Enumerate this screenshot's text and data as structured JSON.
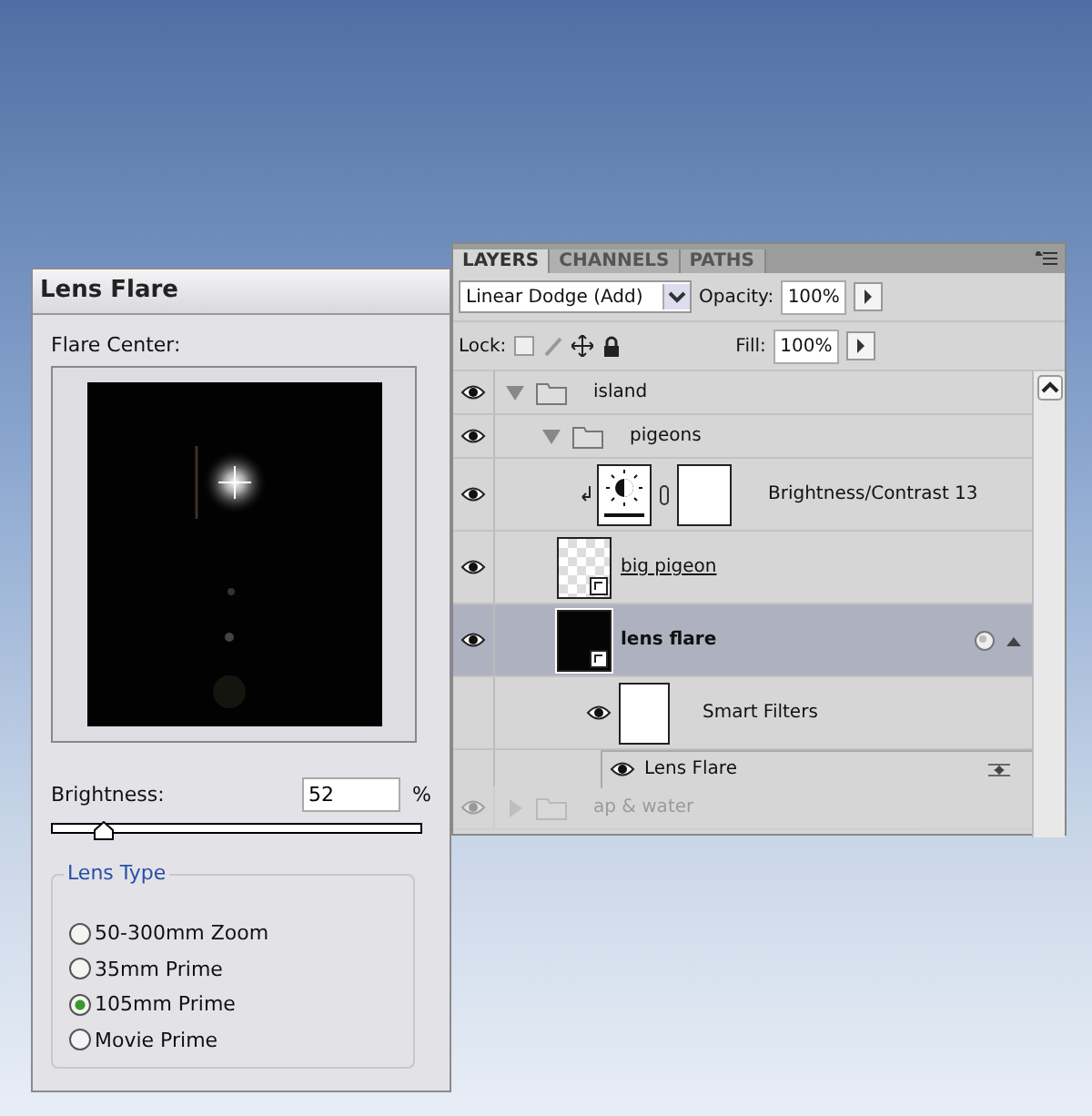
{
  "lens_flare_dialog": {
    "title": "Lens Flare",
    "preview_label": "Flare Center:",
    "brightness_label": "Brightness:",
    "brightness_value": "52",
    "brightness_unit": "%",
    "brightness_slider": {
      "level": 0.14
    },
    "lens_type_title": "Lens Type",
    "lens_types": [
      {
        "label": "50-300mm Zoom",
        "selected": false
      },
      {
        "label": "35mm Prime",
        "selected": false
      },
      {
        "label": "105mm Prime",
        "selected": true
      },
      {
        "label": "Movie Prime",
        "selected": false
      }
    ]
  },
  "layers_panel": {
    "tabs": [
      {
        "label": "LAYERS",
        "selected": true
      },
      {
        "label": "CHANNELS",
        "selected": false
      },
      {
        "label": "PATHS",
        "selected": false
      }
    ],
    "blend_mode": "Linear Dodge (Add)",
    "opacity_label": "Opacity:",
    "opacity": "100%",
    "lock_label": "Lock:",
    "fill_label": "Fill:",
    "fill": "100%",
    "layers": [
      {
        "name": "island",
        "kind": "group",
        "visible": true,
        "expanded": true,
        "faded": false,
        "children": [
          {
            "name": "pigeons",
            "kind": "group",
            "visible": true,
            "expanded": true,
            "faded": false,
            "children": [
              {
                "name": "Brightness/Contrast 13",
                "kind": "adjustment",
                "visible": true,
                "selected": false
              },
              {
                "name": "big pigeon",
                "kind": "smart",
                "transparent_thumb": true,
                "underlined": true,
                "visible": true,
                "selected": false
              },
              {
                "name": "lens flare",
                "kind": "smart",
                "transparent_thumb": false,
                "underlined": false,
                "visible": true,
                "selected": true,
                "filters": {
                  "label": "Smart Filters",
                  "visible": true,
                  "items": [
                    {
                      "name": "Lens Flare",
                      "visible": true
                    }
                  ]
                }
              }
            ]
          }
        ]
      },
      {
        "name": "ap & water",
        "kind": "group",
        "visible": true,
        "expanded": false,
        "faded": true
      }
    ]
  }
}
